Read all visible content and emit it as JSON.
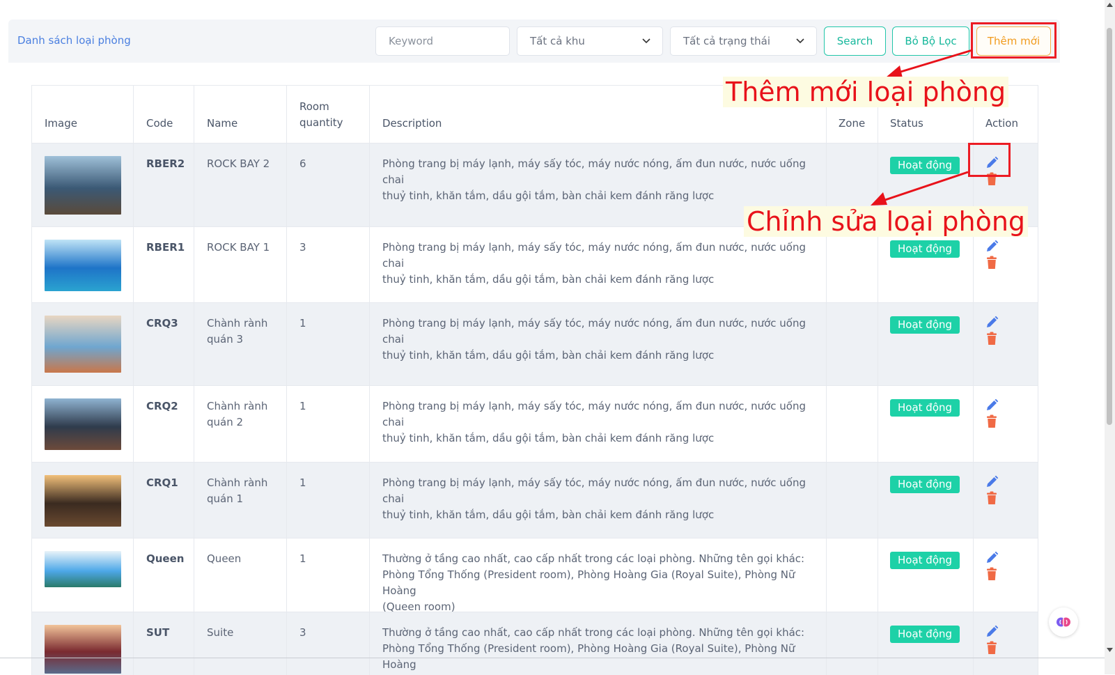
{
  "header": {
    "title": "Danh sách loại phòng",
    "keyword_placeholder": "Keyword",
    "zone_select": "Tất cả khu",
    "status_select": "Tất cả trạng thái",
    "search_label": "Search",
    "clear_filter_label": "Bỏ Bộ Lọc",
    "add_new_label": "Thêm mới"
  },
  "annotations": {
    "add_callout": "Thêm mới loại phòng",
    "edit_callout": "Chỉnh sửa loại phòng"
  },
  "table": {
    "columns": {
      "image": "Image",
      "code": "Code",
      "name": "Name",
      "room_quantity_1": "Room",
      "room_quantity_2": "quantity",
      "description": "Description",
      "zone": "Zone",
      "status": "Status",
      "action": "Action"
    },
    "rows": [
      {
        "code": "RBER2",
        "name_1": "ROCK BAY 2",
        "name_2": "",
        "quantity": "6",
        "desc_1": "Phòng trang bị máy lạnh, máy sấy tóc, máy nước nóng, ấm đun nước, nước uống chai",
        "desc_2": "thuỷ tinh, khăn tắm, dầu gội tắm, bàn chải kem đánh răng lược",
        "desc_3": "",
        "zone": "",
        "status": "Hoạt động"
      },
      {
        "code": "RBER1",
        "name_1": "ROCK BAY 1",
        "name_2": "",
        "quantity": "3",
        "desc_1": "Phòng trang bị máy lạnh, máy sấy tóc, máy nước nóng, ấm đun nước, nước uống chai",
        "desc_2": "thuỷ tinh, khăn tắm, dầu gội tắm, bàn chải kem đánh răng lược",
        "desc_3": "",
        "zone": "",
        "status": "Hoạt động"
      },
      {
        "code": "CRQ3",
        "name_1": "Chành rành",
        "name_2": "quán 3",
        "quantity": "1",
        "desc_1": "Phòng trang bị máy lạnh, máy sấy tóc, máy nước nóng, ấm đun nước, nước uống chai",
        "desc_2": "thuỷ tinh, khăn tắm, dầu gội tắm, bàn chải kem đánh răng lược",
        "desc_3": "",
        "zone": "",
        "status": "Hoạt động"
      },
      {
        "code": "CRQ2",
        "name_1": "Chành rành",
        "name_2": "quán 2",
        "quantity": "1",
        "desc_1": "Phòng trang bị máy lạnh, máy sấy tóc, máy nước nóng, ấm đun nước, nước uống chai",
        "desc_2": "thuỷ tinh, khăn tắm, dầu gội tắm, bàn chải kem đánh răng lược",
        "desc_3": "",
        "zone": "",
        "status": "Hoạt động"
      },
      {
        "code": "CRQ1",
        "name_1": "Chành rành",
        "name_2": "quán 1",
        "quantity": "1",
        "desc_1": "Phòng trang bị máy lạnh, máy sấy tóc, máy nước nóng, ấm đun nước, nước uống chai",
        "desc_2": "thuỷ tinh, khăn tắm, dầu gội tắm, bàn chải kem đánh răng lược",
        "desc_3": "",
        "zone": "",
        "status": "Hoạt động"
      },
      {
        "code": "Queen",
        "name_1": "Queen",
        "name_2": "",
        "quantity": "1",
        "desc_1": "Thường ở tầng cao nhất, cao cấp nhất trong các loại phòng. Những tên gọi khác:",
        "desc_2": "Phòng Tổng Thống (President room), Phòng Hoàng Gia (Royal Suite), Phòng Nữ Hoàng",
        "desc_3": "(Queen room)",
        "zone": "",
        "status": "Hoạt động"
      },
      {
        "code": "SUT",
        "name_1": "Suite",
        "name_2": "",
        "quantity": "3",
        "desc_1": "Thường ở tầng cao nhất, cao cấp nhất trong các loại phòng. Những tên gọi khác:",
        "desc_2": "Phòng Tổng Thống (President room), Phòng Hoàng Gia (Royal Suite), Phòng Nữ Hoàng",
        "desc_3": "",
        "zone": "",
        "status": "Hoạt động"
      }
    ]
  },
  "colors": {
    "accent": "#4a7fe0",
    "status_badge": "#1dd1a7",
    "delete_icon": "#f06a45",
    "edit_icon": "#4a7ae8",
    "annotation_red": "#e8121a"
  }
}
